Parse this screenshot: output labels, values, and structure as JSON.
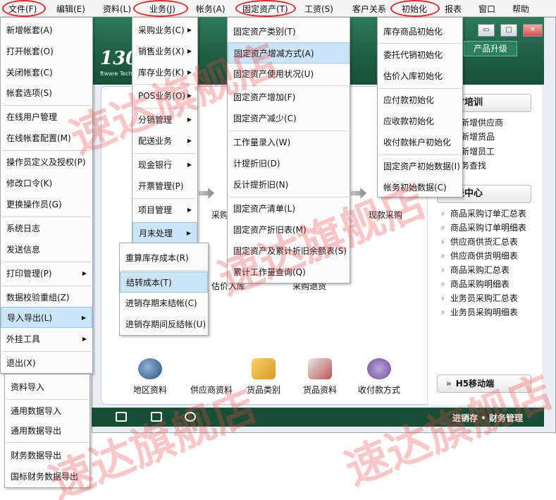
{
  "menubar": {
    "items": [
      "文件(F)",
      "编辑(E)",
      "资料(L)",
      "业务(J)",
      "帐务(A)",
      "固定资产(T)",
      "工资(S)",
      "客户关系",
      "初始化",
      "报表",
      "窗口",
      "帮助"
    ]
  },
  "banner": {
    "logo_text": "13000",
    "logo_sub": "ftware Technolo",
    "upgrade_label": "产品升级"
  },
  "file_menu": {
    "items": [
      "新增帐套(A)",
      "打开帐套(O)",
      "关闭帐套(C)",
      "帐套选项(S)",
      "在线用户管理",
      "在线帐套配置(M)",
      "操作员定义及授权(P)",
      "修改口令(K)",
      "更换操作员(G)",
      "系统日志",
      "发送信息",
      "打印管理(P)",
      "数据校验重组(Z)",
      "导入导出(L)",
      "外挂工具",
      "退出(X)"
    ]
  },
  "import_submenu": {
    "items": [
      "资料导入",
      "通用数据导入",
      "通用数据导出",
      "财务数据导出",
      "国标财务数据导出"
    ]
  },
  "business_menu": {
    "items": [
      "采购业务(C)",
      "销售业务(X)",
      "库存业务(K)",
      "POS业务(O)",
      "分销管理",
      "配送业务",
      "现金银行",
      "开票管理(P)",
      "项目管理",
      "月末处理"
    ]
  },
  "month_end_submenu": {
    "items": [
      "重算库存成本(R)",
      "结转成本(T)",
      "进销存期末结帐(C)",
      "进销存期间反结帐(U)"
    ]
  },
  "assets_menu": {
    "items": [
      "固定资产类别(T)",
      "固定资产增减方式(A)",
      "固定资产使用状况(U)",
      "固定资产增加(F)",
      "固定资产减少(C)",
      "工作量录入(W)",
      "计提折旧(D)",
      "反计提折旧(N)",
      "固定资产清单(L)",
      "固定资产折旧表(M)",
      "固定资产及累计折旧余额表(S)",
      "累计工作量查询(Q)"
    ]
  },
  "init_menu": {
    "items": [
      "库存商品初始化",
      "委托代销初始化",
      "估价入库初始化",
      "应付款初始化",
      "应收款初始化",
      "收付款帐户初始化",
      "固定资产初始数据(I)",
      "帐务初始数据(C)"
    ]
  },
  "right_panel": {
    "training_title": "全时培训",
    "training_items": [
      "新增供应商",
      "新增货品",
      "新增员工",
      "务查找"
    ],
    "report_title": "报表中心",
    "report_items": [
      "商品采购订单汇总表",
      "商品采购订单明细表",
      "供应商供货汇总表",
      "供应商供货明细表",
      "商品采购汇总表",
      "商品采购明细表",
      "业务员采购汇总表",
      "业务员采购明细表"
    ],
    "mobile_label": "H5移动端"
  },
  "canvas_labels": {
    "purchase_partial": "采购",
    "cash_purchase": "现款采购",
    "estimate_partial": "估价入库",
    "return_partial": "采购退货"
  },
  "bottom_icons": [
    "地区资料",
    "供应商资料",
    "货品类别",
    "货品资料",
    "收付款方式"
  ],
  "statusbar": {
    "title": "进销存 • 财务管理"
  },
  "watermark": {
    "text": "速达旗舰店"
  },
  "colors": {
    "banner": "#1f5f46",
    "highlight": "#cce4f7",
    "annotation_ring": "#e3262b",
    "watermark": "#eb4646"
  }
}
